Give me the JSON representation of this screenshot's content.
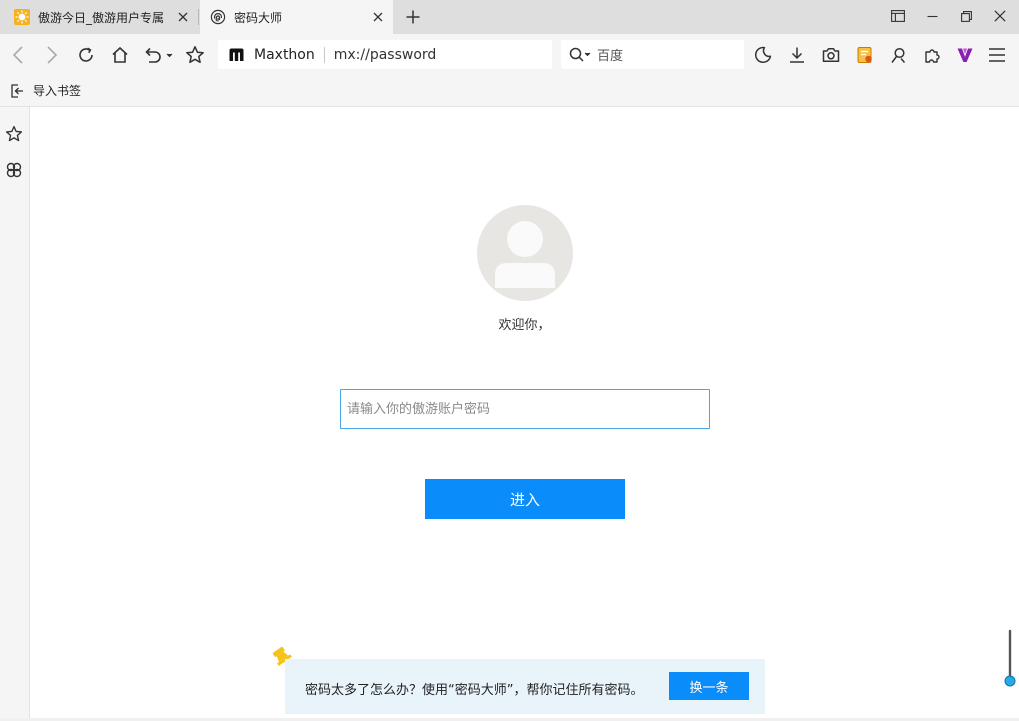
{
  "tabs": [
    {
      "title": "傲游今日_傲游用户专属",
      "icon": "maxthon-today-icon",
      "active": false
    },
    {
      "title": "密码大师",
      "icon": "fingerprint-icon",
      "active": true
    }
  ],
  "address_bar": {
    "brand": "Maxthon",
    "url": "mx://password"
  },
  "search": {
    "engine": "百度"
  },
  "bookmark_bar": {
    "import_label": "导入书签"
  },
  "login": {
    "welcome": "欢迎你，",
    "password_placeholder": "请输入你的傲游账户密码",
    "enter_label": "进入"
  },
  "tip": {
    "text": "密码太多了怎么办？使用“密码大师”，帮你记住所有密码。",
    "button": "换一条"
  },
  "colors": {
    "accent": "#0a8cfb",
    "input_border": "#49a6e8",
    "tip_bg": "#e9f3fa",
    "brand_purple": "#8a1fb4"
  }
}
